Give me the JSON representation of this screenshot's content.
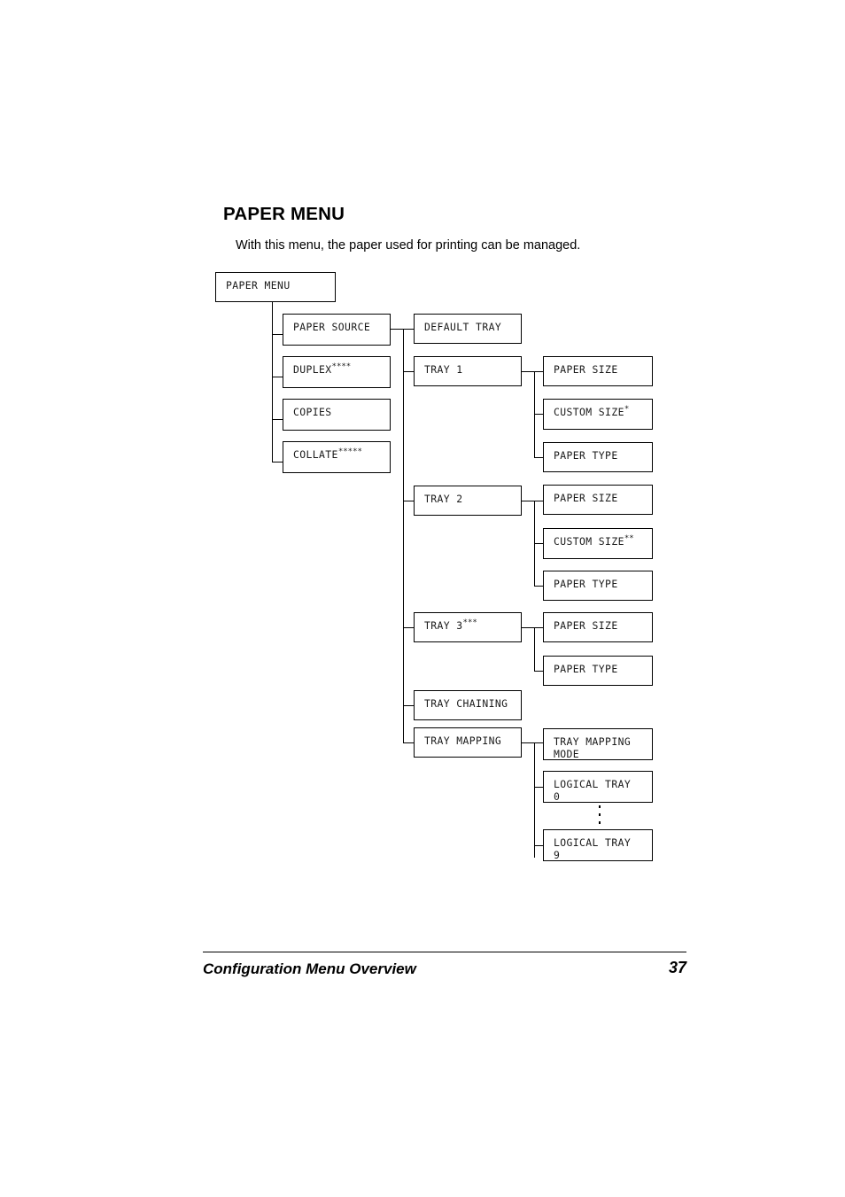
{
  "page": {
    "heading": "PAPER MENU",
    "intro": "With this menu, the paper used for printing can be managed.",
    "footer_title": "Configuration Menu Overview",
    "footer_page_number": "37"
  },
  "diagram": {
    "root": {
      "label": "PAPER MENU"
    },
    "level1": [
      {
        "label": "PAPER SOURCE",
        "marks": ""
      },
      {
        "label": "DUPLEX",
        "marks": "****"
      },
      {
        "label": "COPIES",
        "marks": ""
      },
      {
        "label": "COLLATE",
        "marks": "*****"
      }
    ],
    "level2": [
      {
        "label": "DEFAULT TRAY",
        "marks": ""
      },
      {
        "label": "TRAY 1",
        "marks": ""
      },
      {
        "label": "TRAY 2",
        "marks": ""
      },
      {
        "label": "TRAY 3",
        "marks": "***"
      },
      {
        "label": "TRAY CHAINING",
        "marks": ""
      },
      {
        "label": "TRAY MAPPING",
        "marks": ""
      }
    ],
    "tray1_children": [
      {
        "label": "PAPER SIZE",
        "marks": ""
      },
      {
        "label": "CUSTOM SIZE",
        "marks": "*"
      },
      {
        "label": "PAPER TYPE",
        "marks": ""
      }
    ],
    "tray2_children": [
      {
        "label": "PAPER SIZE",
        "marks": ""
      },
      {
        "label": "CUSTOM SIZE",
        "marks": "**"
      },
      {
        "label": "PAPER TYPE",
        "marks": ""
      }
    ],
    "tray3_children": [
      {
        "label": "PAPER SIZE",
        "marks": ""
      },
      {
        "label": "PAPER TYPE",
        "marks": ""
      }
    ],
    "tray_mapping_children": [
      {
        "label": "TRAY MAPPING\nMODE",
        "marks": ""
      },
      {
        "label": "LOGICAL TRAY\n0",
        "marks": ""
      },
      {
        "label": "LOGICAL TRAY\n9",
        "marks": ""
      }
    ]
  }
}
